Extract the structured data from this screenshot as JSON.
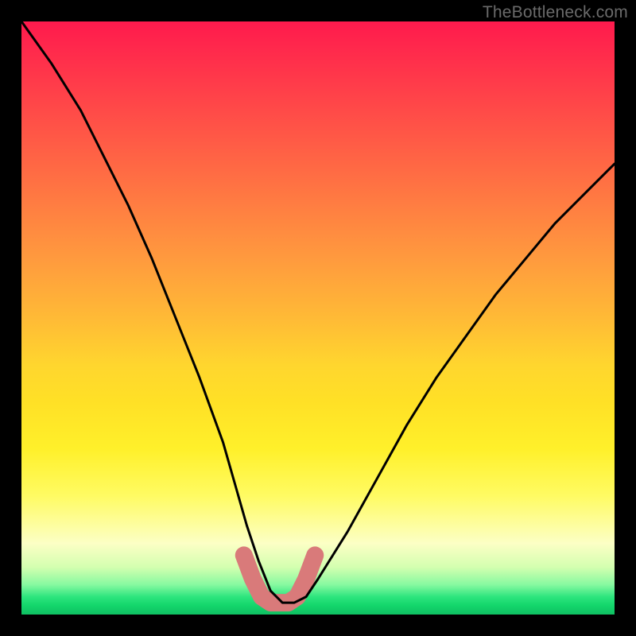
{
  "watermark": "TheBottleneck.com",
  "chart_data": {
    "type": "line",
    "title": "",
    "xlabel": "",
    "ylabel": "",
    "xlim": [
      0,
      100
    ],
    "ylim": [
      0,
      100
    ],
    "series": [
      {
        "name": "bottleneck-curve",
        "x": [
          0,
          5,
          10,
          14,
          18,
          22,
          26,
          30,
          34,
          36,
          38,
          40,
          42,
          44,
          46,
          48,
          50,
          55,
          60,
          65,
          70,
          75,
          80,
          85,
          90,
          95,
          100
        ],
        "values": [
          100,
          93,
          85,
          77,
          69,
          60,
          50,
          40,
          29,
          22,
          15,
          9,
          4,
          2,
          2,
          3,
          6,
          14,
          23,
          32,
          40,
          47,
          54,
          60,
          66,
          71,
          76
        ]
      }
    ],
    "highlight": {
      "name": "optimal-zone",
      "x": [
        37.5,
        39.0,
        40.5,
        42.0,
        43.5,
        45.0,
        46.5,
        48.0,
        49.5
      ],
      "values": [
        10.0,
        6.0,
        3.0,
        2.0,
        2.0,
        2.0,
        3.0,
        6.0,
        10.0
      ]
    },
    "colors": {
      "curve": "#000000",
      "highlight": "#d97a7a"
    }
  }
}
